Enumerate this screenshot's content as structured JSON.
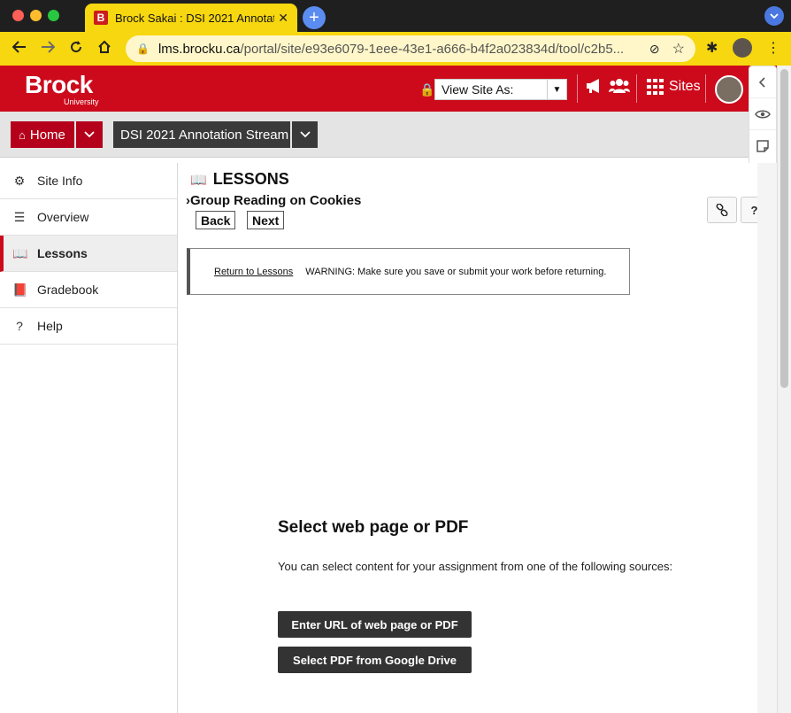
{
  "browser": {
    "tab_title": "Brock Sakai : DSI 2021 Annotat",
    "tab_favicon": "B",
    "url_host": "lms.brocku.ca",
    "url_path": "/portal/site/e93e6079-1eee-43e1-a666-b4f2a023834d/tool/c2b5...",
    "new_tab": "+",
    "tab_close": "✕"
  },
  "header": {
    "logo": "Brock",
    "logo_sub": "University",
    "view_site_as": "View Site As:",
    "sites_label": "Sites"
  },
  "nav": {
    "home_label": "Home",
    "site_label": "DSI 2021 Annotation Stream"
  },
  "sidebar": {
    "items": [
      {
        "label": "Site Info",
        "icon": "gear-icon"
      },
      {
        "label": "Overview",
        "icon": "list-icon"
      },
      {
        "label": "Lessons",
        "icon": "book-open-icon"
      },
      {
        "label": "Gradebook",
        "icon": "book-icon"
      },
      {
        "label": "Help",
        "icon": "question-circle-icon"
      }
    ]
  },
  "main": {
    "title": "LESSONS",
    "breadcrumb": "Group Reading on Cookies",
    "back_label": "Back",
    "next_label": "Next",
    "help_label": "?",
    "return_link": "Return to Lessons",
    "warning": "WARNING: Make sure you save or submit your work before returning.",
    "select_title": "Select web page or PDF",
    "select_desc": "You can select content for your assignment from one of the following sources:",
    "url_button": "Enter URL of web page or PDF",
    "drive_button": "Select PDF from Google Drive"
  },
  "colors": {
    "brand_red": "#cc0a1c",
    "browser_yellow": "#f7d70f"
  }
}
